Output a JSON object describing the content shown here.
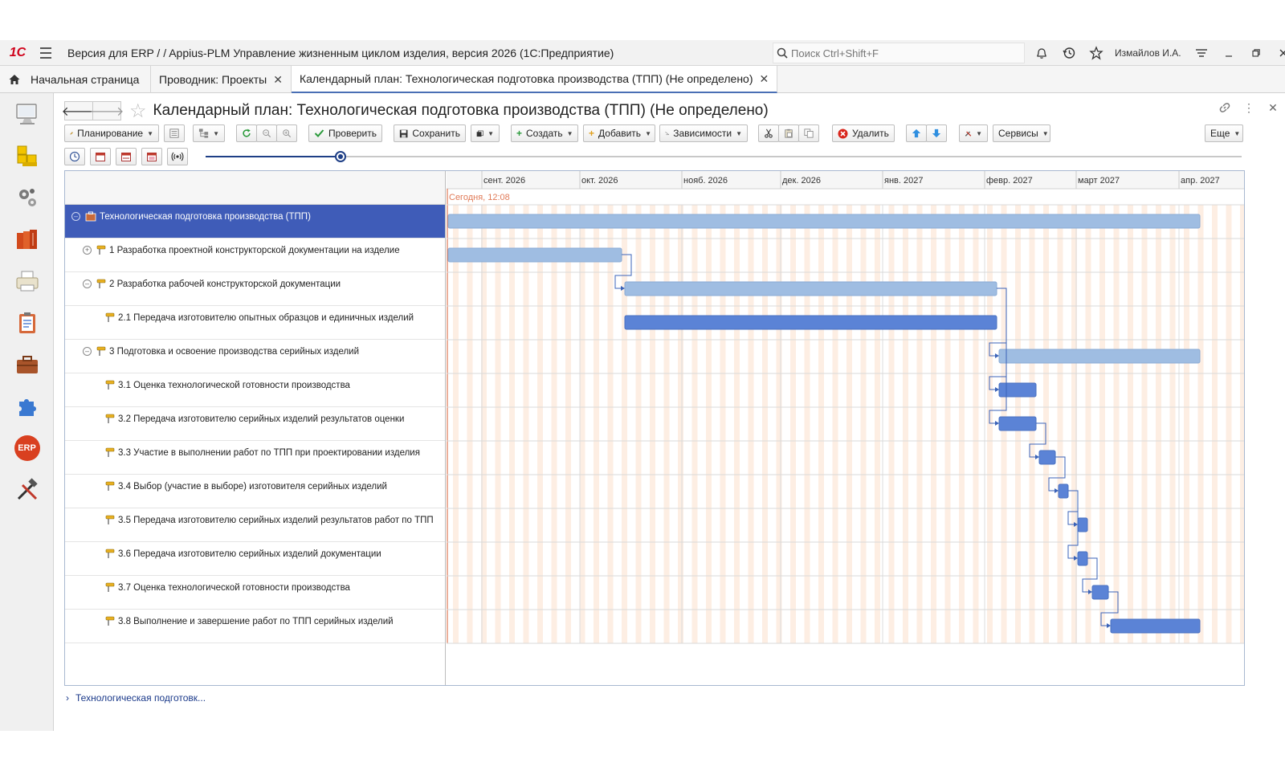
{
  "app": {
    "logo": "1С",
    "title": "Версия для ERP /  / Appius-PLM Управление жизненным циклом изделия, версия 2026  (1С:Предприятие)",
    "search_placeholder": "Поиск Ctrl+Shift+F",
    "user": "Измайлов И.А."
  },
  "tabs": [
    {
      "label": "Начальная страница"
    },
    {
      "label": "Проводник: Проекты"
    },
    {
      "label": "Календарный план: Технологическая подготовка производства (ТПП) (Не определено)"
    }
  ],
  "left_panel": [
    "monitor-icon",
    "stacks-icon",
    "gears-icon",
    "books-icon",
    "printer-icon",
    "clipboard-icon",
    "briefcase-icon",
    "puzzle-icon",
    "erp-icon",
    "tools-icon"
  ],
  "erp_badge": "ERP",
  "page": {
    "title": "Календарный план: Технологическая подготовка производства (ТПП) (Не определено)"
  },
  "toolbar": {
    "planning": "Планирование",
    "check": "Проверить",
    "save": "Сохранить",
    "create": "Создать",
    "add": "Добавить",
    "dependencies": "Зависимости",
    "delete": "Удалить",
    "services": "Сервисы",
    "more": "Еще"
  },
  "timeline": {
    "zoom_fraction": 0.13,
    "months": [
      "сент. 2026",
      "окт. 2026",
      "нояб. 2026",
      "дек. 2026",
      "янв. 2027",
      "февр. 2027",
      "март 2027",
      "апр. 2027"
    ],
    "today_label": "Сегодня, 12:08"
  },
  "tasks": [
    {
      "label": "Технологическая подготовка производства (ТПП)",
      "level": 0,
      "expander": "⊖",
      "icon": "project-icon",
      "selected": true
    },
    {
      "label": "1 Разработка проектной конструкторской документации на изделие",
      "level": 1,
      "expander": "⊕",
      "icon": "pin-icon"
    },
    {
      "label": "2 Разработка рабочей конструкторской документации",
      "level": 1,
      "expander": "⊖",
      "icon": "pin-icon"
    },
    {
      "label": "2.1 Передача изготовителю опытных образцов и единичных изделий",
      "level": 2,
      "expander": "",
      "icon": "pin-icon"
    },
    {
      "label": "3 Подготовка и освоение производства серийных изделий",
      "level": 1,
      "expander": "⊖",
      "icon": "pin-icon"
    },
    {
      "label": "3.1 Оценка технологической готовности производства",
      "level": 2,
      "expander": "",
      "icon": "pin-icon"
    },
    {
      "label": "3.2 Передача изготовителю серийных изделий результатов оценки",
      "level": 2,
      "expander": "",
      "icon": "pin-icon"
    },
    {
      "label": "3.3 Участие в выполнении работ по ТПП при проектировании изделия",
      "level": 2,
      "expander": "",
      "icon": "pin-icon"
    },
    {
      "label": "3.4 Выбор (участие в выборе) изготовителя серийных изделий",
      "level": 2,
      "expander": "",
      "icon": "pin-icon"
    },
    {
      "label": "3.5 Передача изготовителю серийных изделий результатов работ по ТПП",
      "level": 2,
      "expander": "",
      "icon": "pin-icon"
    },
    {
      "label": "3.6 Передача изготовителю серийных изделий документации",
      "level": 2,
      "expander": "",
      "icon": "pin-icon"
    },
    {
      "label": "3.7 Оценка технологической готовности производства",
      "level": 2,
      "expander": "",
      "icon": "pin-icon"
    },
    {
      "label": "3.8 Выполнение и завершение работ по ТПП серийных изделий",
      "level": 2,
      "expander": "",
      "icon": "pin-icon"
    }
  ],
  "footer": {
    "breadcrumb": "Технологическая подготовк..."
  },
  "colors": {
    "selection": "#3f5cb8",
    "summary_bar": "#9fbde2",
    "task_bar": "#5b83d6",
    "weekend": "#fdeee3",
    "today": "#e07a57"
  }
}
